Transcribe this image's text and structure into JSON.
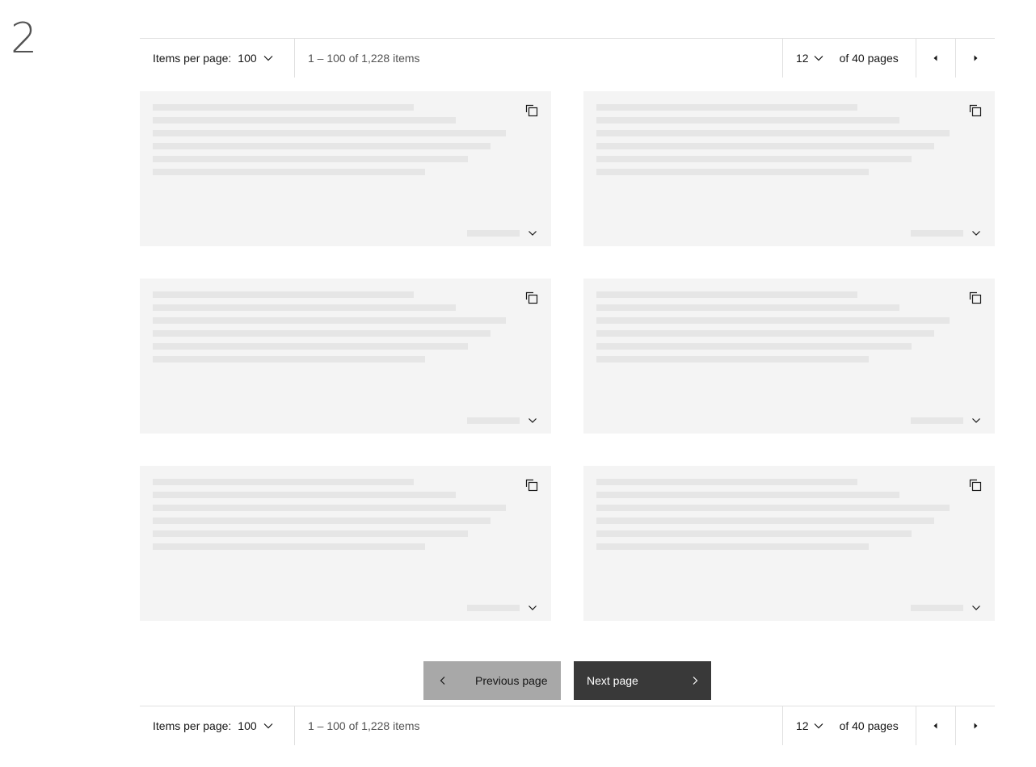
{
  "section": {
    "number": "2"
  },
  "pagination": {
    "items_per_page_label": "Items per page:",
    "items_per_page_value": "100",
    "range_text": "1 – 100 of 1,228 items",
    "current_page": "12",
    "total_pages_text": "of 40 pages",
    "prev_icon": "caret-left-icon",
    "next_icon": "caret-right-icon"
  },
  "cards": [
    {
      "state": "loading",
      "copy_icon": "copy-icon",
      "expand_icon": "chevron-down-icon",
      "skeleton_line_fractions": [
        0.68,
        0.79,
        0.92,
        0.88,
        0.82,
        0.71
      ]
    },
    {
      "state": "loading",
      "copy_icon": "copy-icon",
      "expand_icon": "chevron-down-icon",
      "skeleton_line_fractions": [
        0.68,
        0.79,
        0.92,
        0.88,
        0.82,
        0.71
      ]
    },
    {
      "state": "loading",
      "copy_icon": "copy-icon",
      "expand_icon": "chevron-down-icon",
      "skeleton_line_fractions": [
        0.68,
        0.79,
        0.92,
        0.88,
        0.82,
        0.71
      ]
    },
    {
      "state": "loading",
      "copy_icon": "copy-icon",
      "expand_icon": "chevron-down-icon",
      "skeleton_line_fractions": [
        0.68,
        0.79,
        0.92,
        0.88,
        0.82,
        0.71
      ]
    },
    {
      "state": "loading",
      "copy_icon": "copy-icon",
      "expand_icon": "chevron-down-icon",
      "skeleton_line_fractions": [
        0.68,
        0.79,
        0.92,
        0.88,
        0.82,
        0.71
      ]
    },
    {
      "state": "loading",
      "copy_icon": "copy-icon",
      "expand_icon": "chevron-down-icon",
      "skeleton_line_fractions": [
        0.68,
        0.79,
        0.92,
        0.88,
        0.82,
        0.71
      ]
    }
  ],
  "buttons": {
    "previous_label": "Previous page",
    "next_label": "Next page"
  },
  "colors": {
    "card_background": "#f4f4f4",
    "skeleton": "#e6e6e6",
    "previous_button": "#a8a8a8",
    "next_button": "#393939",
    "border": "#e0e0e0"
  }
}
